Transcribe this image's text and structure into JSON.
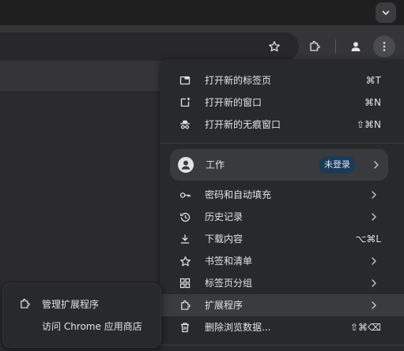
{
  "toolbar": {
    "tabs_dropdown_icon": "chevron-down-icon",
    "bookmark_icon": "star-icon",
    "extensions_icon": "puzzle-icon",
    "profile_icon": "person-icon",
    "menu_icon": "three-dots-icon"
  },
  "menu": {
    "items_top": [
      {
        "label": "打开新的标签页",
        "shortcut": "⌘T",
        "icon": "new-tab-icon"
      },
      {
        "label": "打开新的窗口",
        "shortcut": "⌘N",
        "icon": "new-window-icon"
      },
      {
        "label": "打开新的无痕窗口",
        "shortcut": "⇧⌘N",
        "icon": "incognito-icon"
      }
    ],
    "profile": {
      "label": "工作",
      "badge": "未登录",
      "icon": "person-icon"
    },
    "items_mid": [
      {
        "label": "密码和自动填充",
        "icon": "key-icon",
        "submenu": true
      },
      {
        "label": "历史记录",
        "icon": "history-icon",
        "submenu": true
      },
      {
        "label": "下载内容",
        "shortcut": "⌥⌘L",
        "icon": "download-icon"
      },
      {
        "label": "书签和清单",
        "icon": "star-icon",
        "submenu": true
      },
      {
        "label": "标签页分组",
        "icon": "grid-icon",
        "submenu": true
      },
      {
        "label": "扩展程序",
        "icon": "puzzle-icon",
        "submenu": true
      },
      {
        "label": "删除浏览数据...",
        "shortcut": "⇧⌘⌫",
        "icon": "trash-icon"
      }
    ]
  },
  "submenu": {
    "items": [
      {
        "label": "管理扩展程序",
        "icon": "puzzle-icon"
      },
      {
        "label": "访问 Chrome 应用商店",
        "icon": ""
      }
    ]
  },
  "colors": {
    "menu_bg": "#28292b",
    "highlight": "#3a3b3d",
    "badge_bg": "#1b3a55"
  }
}
